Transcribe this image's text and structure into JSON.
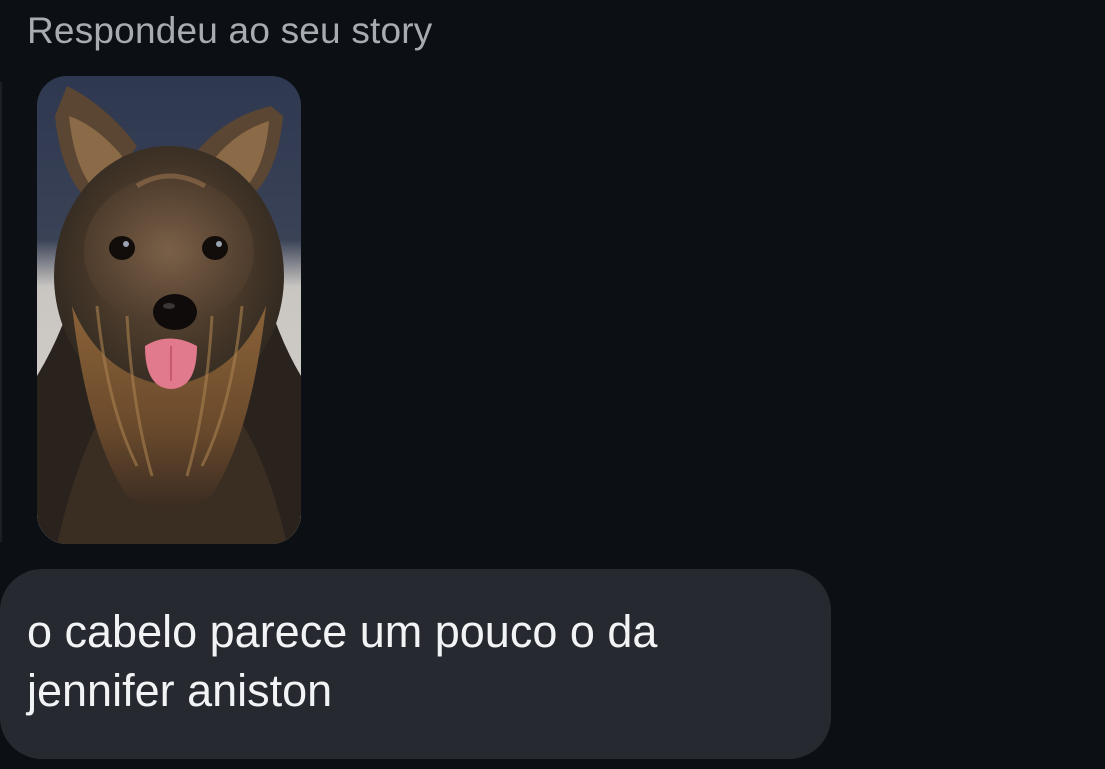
{
  "thread": {
    "reply_context_label": "Respondeu ao seu story",
    "story": {
      "image_subject": "yorkshire terrier photo"
    },
    "message": {
      "text": "o cabelo parece um pouco o da jennifer aniston"
    }
  },
  "colors": {
    "background": "#0c1014",
    "bubble": "#262a30",
    "header_text": "#a8acb2",
    "message_text": "#f2f3f5"
  }
}
